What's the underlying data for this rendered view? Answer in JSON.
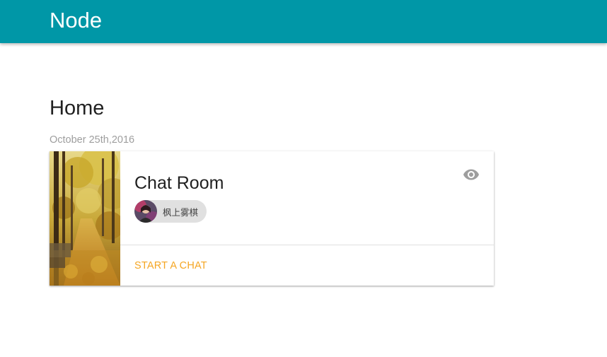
{
  "appbar": {
    "title": "Node",
    "color": "#0097a7"
  },
  "page": {
    "title": "Home"
  },
  "post": {
    "date": "October 25th,2016",
    "card": {
      "title": "Chat Room",
      "view_icon": "eye-icon",
      "author": {
        "name": "枫上雾棋"
      },
      "action_label": "START A CHAT",
      "accent_color": "#f5a623"
    }
  }
}
